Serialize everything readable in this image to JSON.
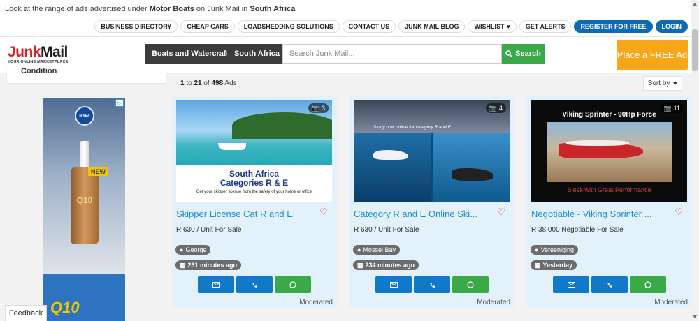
{
  "intro": {
    "prefix": "Look at the range of ads advertised under ",
    "category": "Motor Boats",
    "middle": " on Junk Mail in ",
    "region": "South Africa"
  },
  "toplinks": [
    {
      "label": "BUSINESS DIRECTORY"
    },
    {
      "label": "CHEAP CARS"
    },
    {
      "label": "LOADSHEDDING SOLUTIONS"
    },
    {
      "label": "CONTACT US"
    },
    {
      "label": "JUNK MAIL BLOG"
    },
    {
      "label": "WISHLIST"
    },
    {
      "label": "GET ALERTS"
    },
    {
      "label": "REGISTER FOR FREE"
    },
    {
      "label": "LOGIN"
    }
  ],
  "logo": {
    "junk": "Junk",
    "mail": "Mail",
    "tagline": "YOUR ONLINE MARKETPLACE"
  },
  "search": {
    "category": "Boats and Watercraft",
    "region": "South Africa",
    "placeholder": "Search Junk Mail...",
    "button": "Search"
  },
  "place_ad": "Place a FREE Ad",
  "sidebar": {
    "filter_label": "Condition"
  },
  "ad_banner": {
    "brand": "NIVEA",
    "badge": "NEW",
    "product": "Q10",
    "product_big": "Q10"
  },
  "results": {
    "from": "1",
    "to": "21",
    "total": "498",
    "to_word": " to ",
    "of_word": " of ",
    "ads_word": " Ads",
    "sort_label": "Sort by"
  },
  "listings": [
    {
      "photos": "3",
      "title": "Skipper License Cat R and E",
      "price": "R 630 / Unit For Sale",
      "location": "George",
      "time": "231 minutes ago",
      "status": "Moderated",
      "img_l1": "South Africa",
      "img_l2": "Categories R & E",
      "img_l3": "Get your skipper license from the safety of your home or office"
    },
    {
      "photos": "4",
      "title": "Category R and E Online Ski...",
      "price": "R 630 / Unit For Sale",
      "location": "Mossel Bay",
      "time": "234 minutes ago",
      "status": "Moderated",
      "img_l1": "Study now online for category R and E"
    },
    {
      "photos": "11",
      "title": "Negotiable - Viking Sprinter ...",
      "price": "R 38 000 Negotiable For Sale",
      "location": "Vereeniging",
      "time": "Yesterday",
      "status": "Moderated",
      "img_l1": "Viking Sprinter - 90Hp Force",
      "img_l3": "Sleek with Great Performance"
    }
  ],
  "feedback": "Feedback",
  "colors": {
    "brand_red": "#d6232a",
    "accent_blue": "#0d6ab5",
    "search_green": "#3aaa48",
    "cta_orange": "#f9a61a",
    "link_blue": "#1a8fd0",
    "card_bg": "#e3f1fb"
  }
}
